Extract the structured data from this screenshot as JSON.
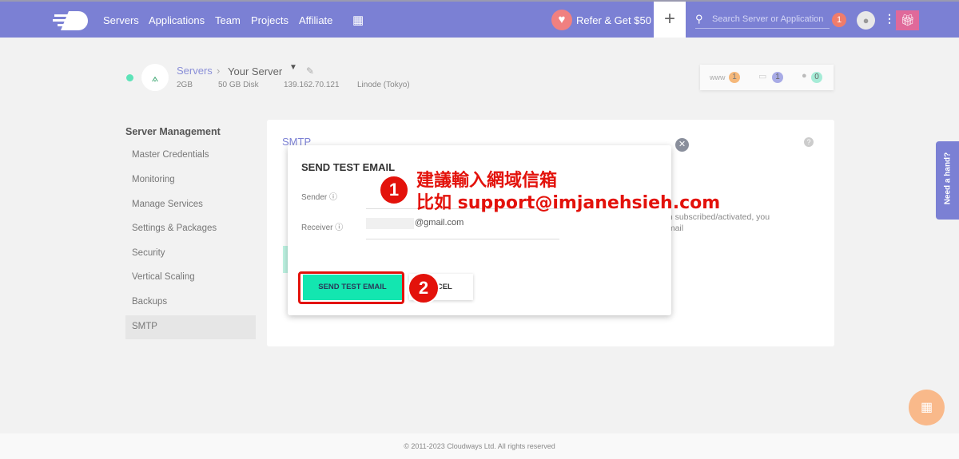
{
  "nav": {
    "items": [
      "Servers",
      "Applications",
      "Team",
      "Projects",
      "Affiliate"
    ],
    "refer": "Refer & Get $50",
    "search_placeholder": "Search Server or Application",
    "notifications": "1"
  },
  "server": {
    "breadcrumb_root": "Servers",
    "name": "Your Server",
    "ram": "2GB",
    "disk": "50 GB Disk",
    "ip": "139.162.70.121",
    "provider": "Linode (Tokyo)",
    "stats": {
      "www_label": "www",
      "www": "1",
      "files": "1",
      "users": "0"
    }
  },
  "sidebar": {
    "title": "Server Management",
    "items": [
      "Master Credentials",
      "Monitoring",
      "Manage Services",
      "Settings & Packages",
      "Security",
      "Vertical Scaling",
      "Backups",
      "SMTP"
    ]
  },
  "card": {
    "title": "SMTP",
    "bg_text_1": "en subscribed/activated, you",
    "bg_text_2": "email"
  },
  "modal": {
    "title": "SEND TEST EMAIL",
    "sender_label": "Sender",
    "receiver_label": "Receiver",
    "receiver_value": "@gmail.com",
    "send_button": "SEND TEST EMAIL",
    "cancel_button": "NCEL"
  },
  "annotation": {
    "step1": "1",
    "step2": "2",
    "line1": "建議輸入網域信箱",
    "line2": "比如 support@imjanehsieh.com"
  },
  "help_tab": "Need a hand?",
  "footer": "© 2011-2023 Cloudways Ltd. All rights reserved",
  "colors": {
    "brand": "#7b80d4",
    "accent": "#13e6b0",
    "annotation": "#e3120b"
  }
}
